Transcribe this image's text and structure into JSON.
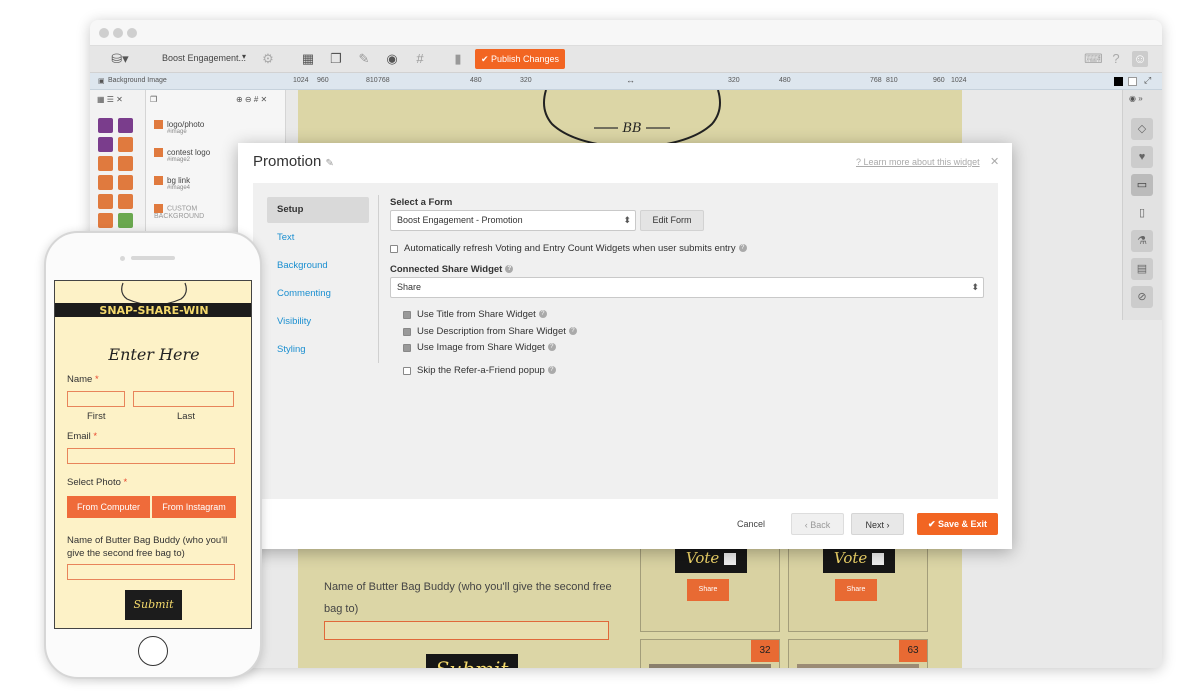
{
  "toolbar": {
    "campaign": "Boost Engagement...",
    "publish": "Publish Changes"
  },
  "ruler": {
    "label": "Background Image",
    "ticks": [
      "1024",
      "960",
      "810",
      "768",
      "480",
      "320",
      "320",
      "480",
      "768",
      "810",
      "960",
      "1024"
    ]
  },
  "layers": [
    {
      "name": "logo/photo",
      "tag": "#image"
    },
    {
      "name": "contest logo",
      "tag": "#image2"
    },
    {
      "name": "bg link",
      "tag": "#image4"
    },
    {
      "name": "CUSTOM BACKGROUND",
      "tag": ""
    }
  ],
  "modal": {
    "title": "Promotion",
    "learn_more": "Learn more about this widget",
    "tabs": [
      "Setup",
      "Text",
      "Background",
      "Commenting",
      "Visibility",
      "Styling"
    ],
    "select_form_label": "Select a Form",
    "form_value": "Boost Engagement - Promotion",
    "edit_form": "Edit Form",
    "auto_refresh": "Automatically refresh Voting and Entry Count Widgets when user submits entry",
    "share_widget_label": "Connected Share Widget",
    "share_value": "Share",
    "use_title": "Use Title from Share Widget",
    "use_description": "Use Description from Share Widget",
    "use_image": "Use Image from Share Widget",
    "skip_refer": "Skip the Refer-a-Friend popup",
    "cancel": "Cancel",
    "back": "Back",
    "next": "Next",
    "save_exit": "Save & Exit"
  },
  "page": {
    "buddy_label": "Name of Butter Bag Buddy (who you'll give the second free bag to)",
    "submit": "Submit",
    "vote": "Vote",
    "share": "Share",
    "counts": [
      "32",
      "63"
    ],
    "logo_text": "BB"
  },
  "phone": {
    "banner": "SNAP-SHARE-WIN",
    "heading": "Enter Here",
    "name_label": "Name",
    "first": "First",
    "last": "Last",
    "email_label": "Email",
    "photo_label": "Select Photo",
    "from_computer": "From Computer",
    "from_instagram": "From Instagram",
    "buddy_label": "Name of Butter Bag Buddy (who you'll give the second free bag to)",
    "submit": "Submit"
  },
  "colors": {
    "accent": "#f26522",
    "link": "#1b8fd0",
    "page_bg": "#dcd6a6",
    "phone_bg": "#fdf2c7"
  }
}
